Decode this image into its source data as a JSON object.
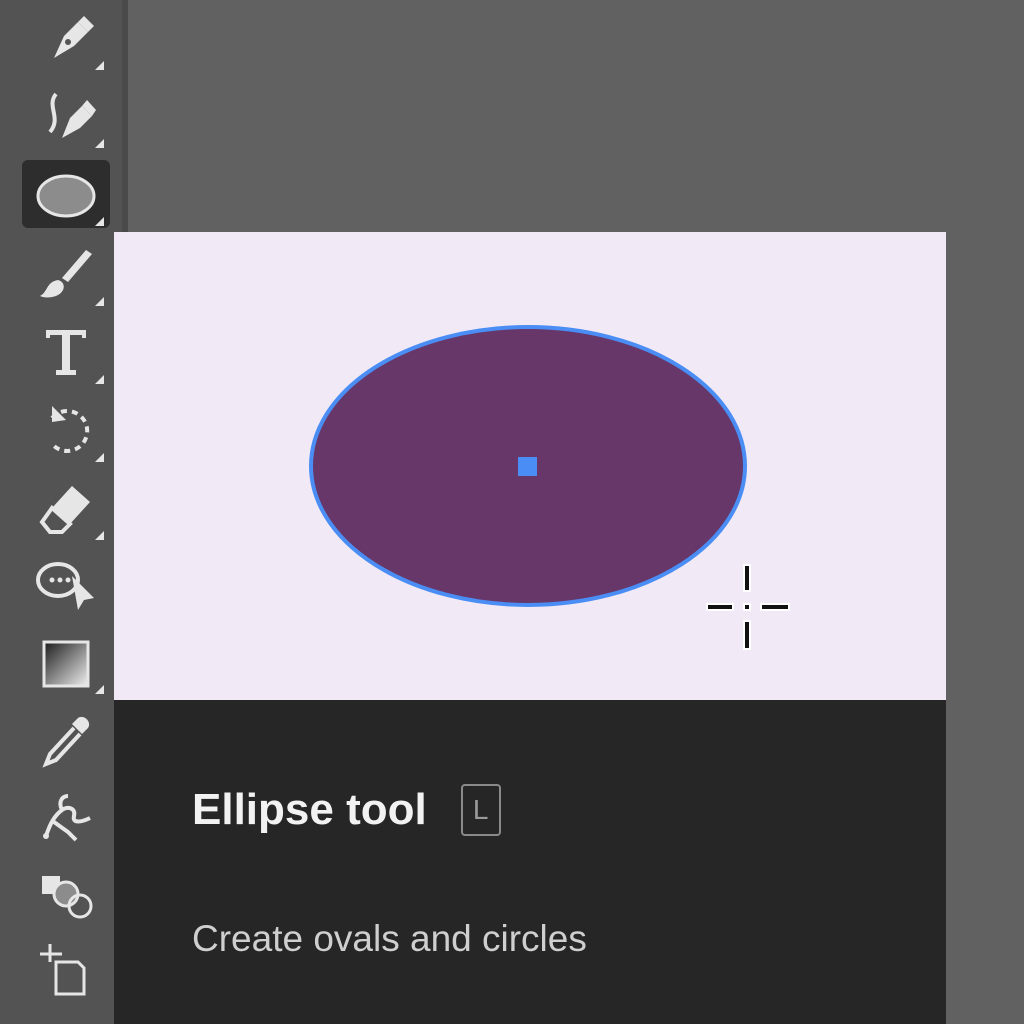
{
  "toolbar": {
    "tools": [
      {
        "icon": "pen-icon",
        "has_submenu": true
      },
      {
        "icon": "curvature-pen-icon",
        "has_submenu": true
      },
      {
        "icon": "ellipse-icon",
        "has_submenu": true,
        "active": true
      },
      {
        "icon": "paintbrush-icon",
        "has_submenu": true
      },
      {
        "icon": "type-icon",
        "has_submenu": true
      },
      {
        "icon": "rotate-icon",
        "has_submenu": true
      },
      {
        "icon": "eraser-icon",
        "has_submenu": true
      },
      {
        "icon": "shape-builder-icon",
        "has_submenu": false
      },
      {
        "icon": "gradient-icon",
        "has_submenu": true
      },
      {
        "icon": "eyedropper-icon",
        "has_submenu": false
      },
      {
        "icon": "puppet-warp-icon",
        "has_submenu": false
      },
      {
        "icon": "symbol-sprayer-icon",
        "has_submenu": false
      },
      {
        "icon": "artboard-icon",
        "has_submenu": false
      }
    ]
  },
  "tooltip": {
    "title": "Ellipse tool",
    "shortcut": "L",
    "description": "Create ovals and circles"
  },
  "colors": {
    "ellipse_fill": "#673769",
    "ellipse_stroke": "#4a8ef5",
    "preview_bg": "#f1e9f5",
    "tooltip_bg": "#262626",
    "toolbar_bg": "#535353",
    "canvas_bg": "#616161"
  }
}
